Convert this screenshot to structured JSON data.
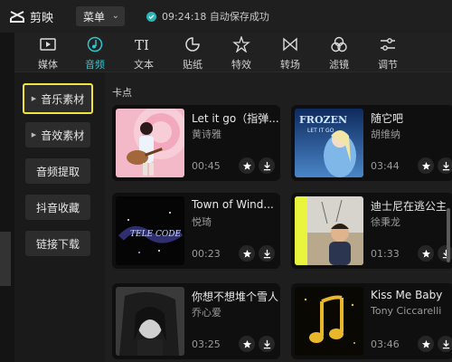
{
  "app": {
    "name": "剪映",
    "menu_label": "菜单",
    "save_status": "09:24:18 自动保存成功"
  },
  "tabs": [
    {
      "label": "媒体",
      "icon": "media-icon"
    },
    {
      "label": "音频",
      "icon": "audio-icon",
      "active": true
    },
    {
      "label": "文本",
      "icon": "text-icon"
    },
    {
      "label": "贴纸",
      "icon": "sticker-icon"
    },
    {
      "label": "特效",
      "icon": "effects-icon"
    },
    {
      "label": "转场",
      "icon": "transition-icon"
    },
    {
      "label": "滤镜",
      "icon": "filter-icon"
    },
    {
      "label": "调节",
      "icon": "adjust-icon"
    }
  ],
  "sidenav": {
    "items": [
      {
        "label": "音乐素材",
        "has_arrow": true,
        "selected": true
      },
      {
        "label": "音效素材",
        "has_arrow": true
      },
      {
        "label": "音频提取"
      },
      {
        "label": "抖音收藏"
      },
      {
        "label": "链接下载"
      }
    ]
  },
  "section": {
    "label": "卡点"
  },
  "tracks": [
    {
      "title": "Let it go（指弹...",
      "artist": "黄诗雅",
      "duration": "00:45"
    },
    {
      "title": "随它吧",
      "artist": "胡维纳",
      "duration": "03:44"
    },
    {
      "title": "Town of Wind...",
      "artist": "悦琦",
      "duration": "00:23"
    },
    {
      "title": "迪士尼在逃公主",
      "artist": "徐秉龙",
      "duration": "01:33"
    },
    {
      "title": "你想不想堆个雪人",
      "artist": "乔心爱",
      "duration": "03:25"
    },
    {
      "title": "Kiss Me Baby",
      "artist": "Tony Ciccarelli",
      "duration": "03:46"
    }
  ],
  "thumb_texts": {
    "frozen": "FROZEN",
    "let_it_go": "LET IT GO",
    "town": "TELE CODE"
  },
  "colors": {
    "accent": "#2ec5d0",
    "highlight": "#f1e43a",
    "check": "#2bb5b5"
  }
}
